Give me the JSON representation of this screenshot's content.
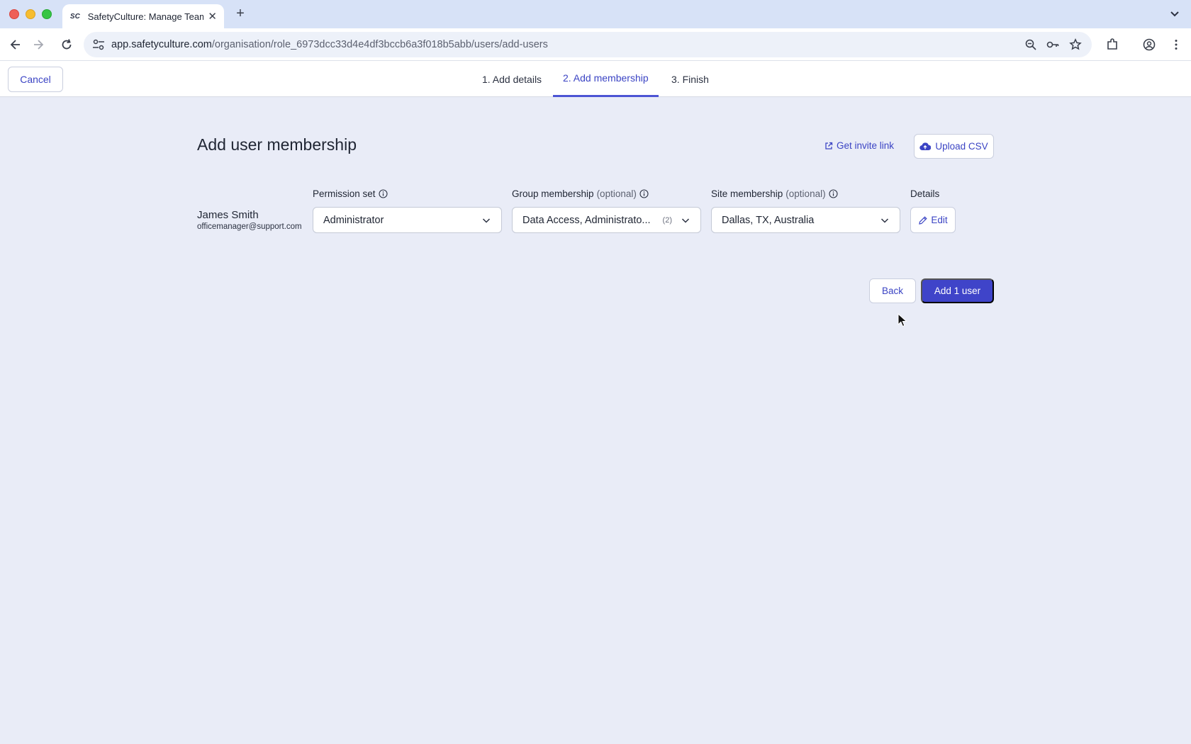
{
  "browser": {
    "tab_title": "SafetyCulture: Manage Teams",
    "favicon_text": "SC",
    "url_host": "app.safetyculture.com",
    "url_path": "/organisation/role_6973dcc33d4e4df3bccb6a3f018b5abb/users/add-users"
  },
  "header": {
    "cancel_label": "Cancel",
    "steps": [
      {
        "label": "1. Add details",
        "active": false
      },
      {
        "label": "2. Add membership",
        "active": true
      },
      {
        "label": "3. Finish",
        "active": false
      }
    ]
  },
  "main": {
    "title": "Add user membership",
    "invite_link_label": "Get invite link",
    "upload_csv_label": "Upload CSV",
    "columns": {
      "permission_set": "Permission set",
      "group_membership": "Group membership",
      "site_membership": "Site membership",
      "optional": "(optional)",
      "details": "Details"
    },
    "user": {
      "name": "James Smith",
      "email": "officemanager@support.com",
      "permission_set": "Administrator",
      "groups": "Data Access, Administrato...",
      "groups_count": "(2)",
      "sites": "Dallas, TX, Australia",
      "edit_label": "Edit"
    },
    "back_label": "Back",
    "add_label": "Add 1 user"
  },
  "colors": {
    "accent": "#3f44c9",
    "background": "#e9ecf7"
  }
}
